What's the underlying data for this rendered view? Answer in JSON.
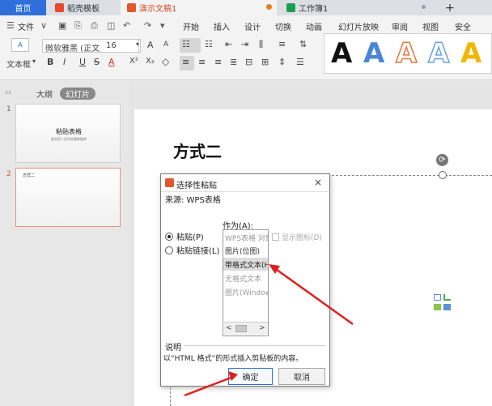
{
  "tabs": {
    "home": "首页",
    "template": "稻壳模板",
    "presentation": "演示文稿1",
    "workbook": "工作簿1",
    "new_tab": "+"
  },
  "menu": {
    "file": "文件",
    "items": [
      "开始",
      "插入",
      "设计",
      "切换",
      "动画",
      "幻灯片放映",
      "审阅",
      "视图",
      "安全"
    ]
  },
  "ribbon": {
    "font_name": "微软雅黑 (正文",
    "font_size": "16",
    "textbox_label": "文本框",
    "style_letter": "A",
    "style_colors": [
      "#111111",
      "#4a86d8",
      "#e8743b",
      "#6aa0e0",
      "#f2b600"
    ]
  },
  "left_panel": {
    "outline_tab": "大纲",
    "slides_tab": "幻灯片",
    "slides": [
      {
        "number": "1",
        "title": "粘贴表格",
        "subtitle": "复合您人员对标题数据库"
      },
      {
        "number": "2",
        "title": "方式二"
      }
    ]
  },
  "slide": {
    "heading": "方式二"
  },
  "dialog": {
    "title": "选择性粘贴",
    "close": "×",
    "source": "来源: WPS表格",
    "as_label": "作为(A):",
    "radio_paste": "粘贴(P)",
    "radio_paste_link": "粘贴链接(L)",
    "list_items": [
      {
        "label": "WPS表格 对象",
        "state": "disabled"
      },
      {
        "label": "图片(位图)",
        "state": "normal"
      },
      {
        "label": "带格式文本(HTML)",
        "state": "selected"
      },
      {
        "label": "无格式文本",
        "state": "disabled"
      },
      {
        "label": "图片(Windows元文件)",
        "state": "disabled"
      }
    ],
    "scroll_left": "<",
    "scroll_right": ">",
    "show_icon": "显示图标(D)",
    "description_label": "说明",
    "description_text": "以“HTML 格式”的形式插入剪贴板的内容。",
    "ok": "确定",
    "cancel": "取消"
  }
}
